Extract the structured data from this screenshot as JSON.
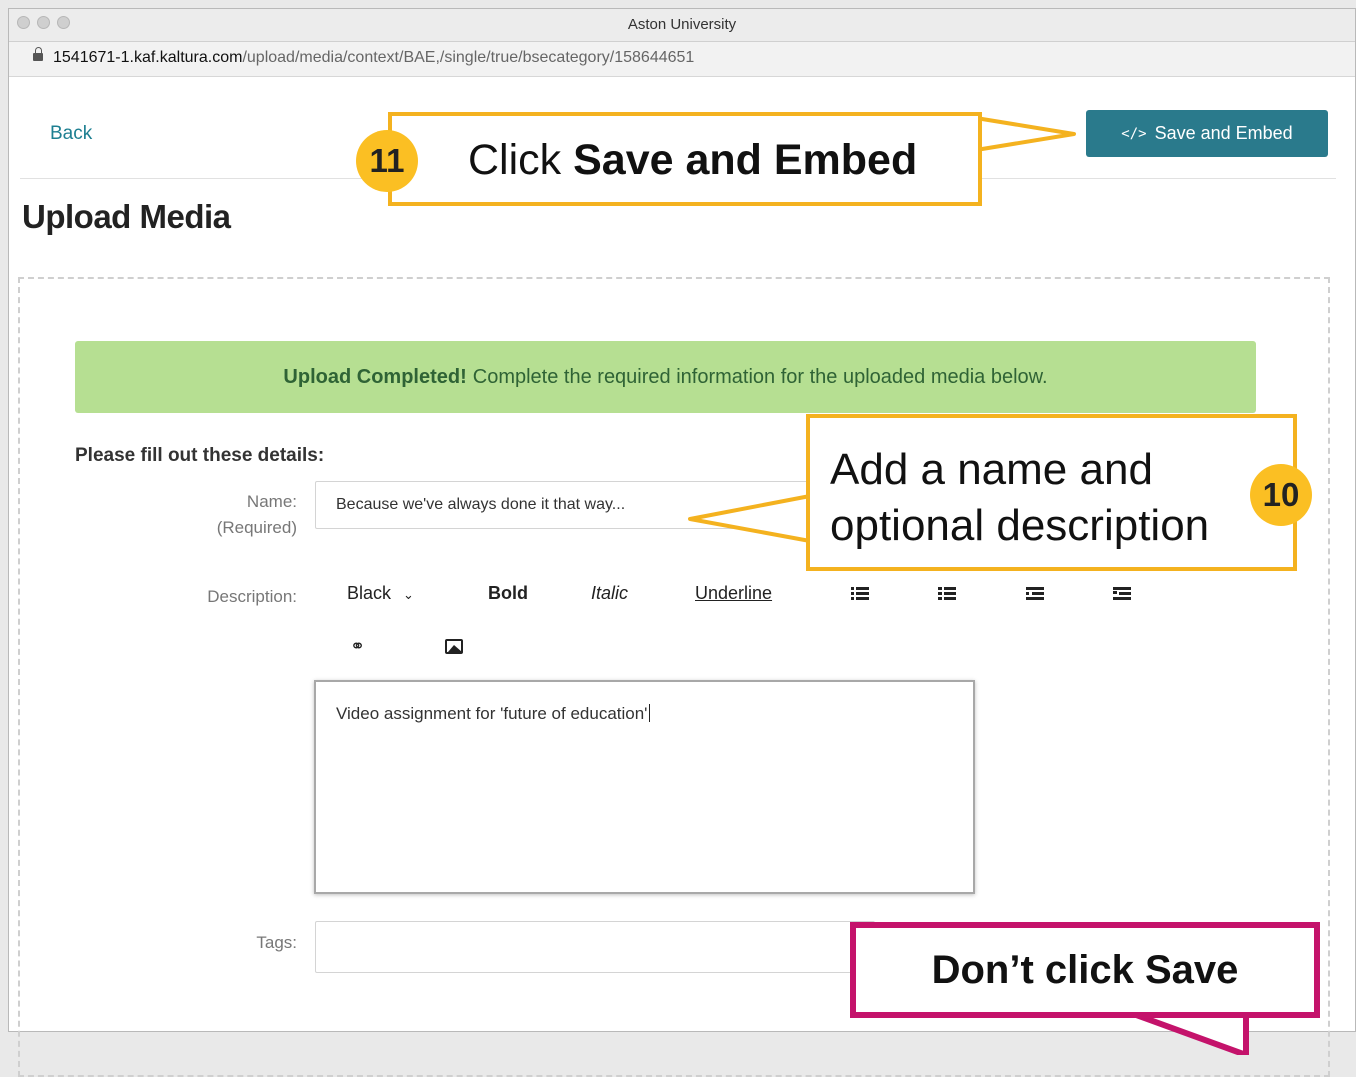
{
  "window": {
    "title": "Aston University"
  },
  "address_bar": {
    "url_host": "1541671-1.kaf.kaltura.com",
    "url_path": "/upload/media/context/BAE,/single/true/bsecategory/158644651"
  },
  "header": {
    "back_label": "Back",
    "save_embed_label": "Save and Embed",
    "save_embed_icon": "</>"
  },
  "page": {
    "title": "Upload Media"
  },
  "banner": {
    "strong": "Upload Completed!",
    "text": "Complete the required information for the uploaded media below."
  },
  "form": {
    "heading": "Please fill out these details:",
    "name_label": "Name:",
    "name_required": "(Required)",
    "name_value": "Because we've always done it that way...",
    "description_label": "Description:",
    "description_value": "Video assignment for 'future of education'",
    "tags_label": "Tags:",
    "toolbar": {
      "color": "Black",
      "bold": "Bold",
      "italic": "Italic",
      "underline": "Underline"
    }
  },
  "annotations": {
    "step11": {
      "number": "11",
      "prefix": "Click ",
      "bold": "Save and Embed"
    },
    "step10": {
      "number": "10",
      "line1": "Add a name and",
      "line2": "optional description"
    },
    "warning": "Don’t click Save",
    "colors": {
      "callout_border": "#f4b21f",
      "badge": "#fbbf23",
      "warning_border": "#c4136b",
      "button": "#2a7a8c",
      "banner": "#b6df92"
    }
  }
}
